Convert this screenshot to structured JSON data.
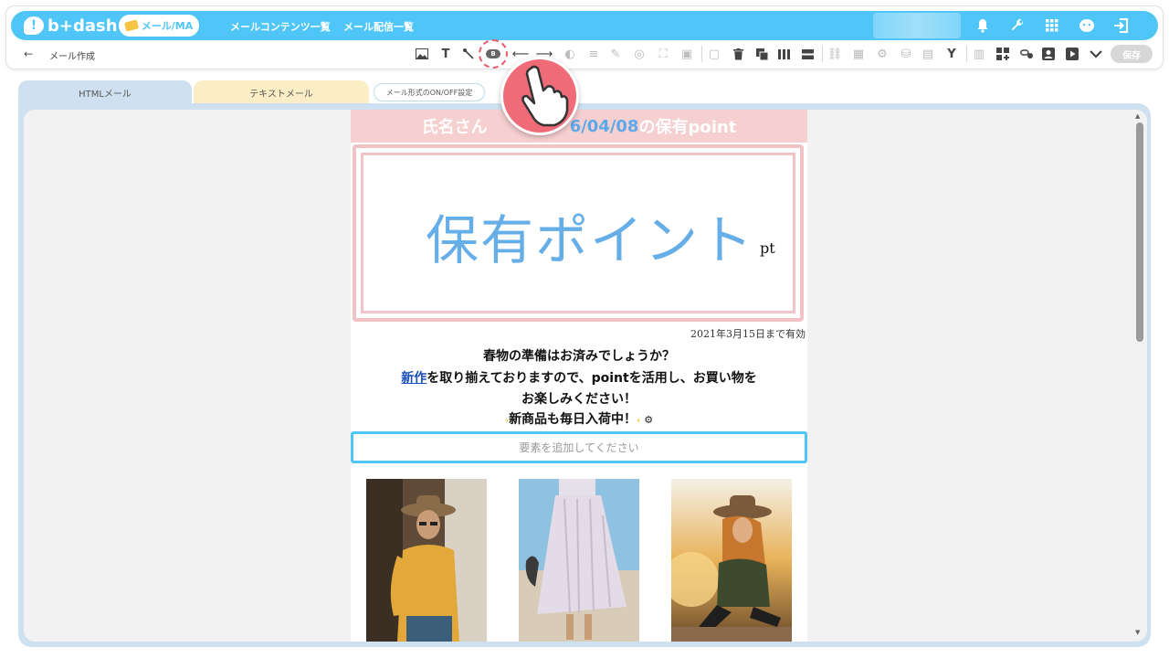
{
  "app": {
    "logo_text": "b+dash",
    "mode_label": "メール/MA"
  },
  "nav": {
    "link1": "メールコンテンツ一覧",
    "link2": "メール配信一覧"
  },
  "subbar": {
    "back": "←",
    "title": "メール作成",
    "save_label": "保存",
    "bold_tag": "B"
  },
  "tabs": {
    "html": "HTMLメール",
    "text": "テキストメール",
    "onoff": "メール形式のON/OFF設定"
  },
  "email": {
    "header_prefix": "氏名さん",
    "header_date": "6/04/08",
    "header_suffix": "の保有point",
    "point_heading": "保有ポイント",
    "point_unit": "pt",
    "valid_until": "2021年3月15日まで有効",
    "line1": "春物の準備はお済みでしょうか？",
    "line2_link": "新作",
    "line2_rest": "を取り揃えておりますので、pointを活用し、お買い物を",
    "line3": "お楽しみください！",
    "line4": "新商品も毎日入荷中！",
    "add_element": "要素を追加してください"
  },
  "colors": {
    "accent": "#4fc6f7",
    "header_pink": "#f6cfd0",
    "point_blue": "#66aee8",
    "highlight_red": "#ee6b77"
  }
}
